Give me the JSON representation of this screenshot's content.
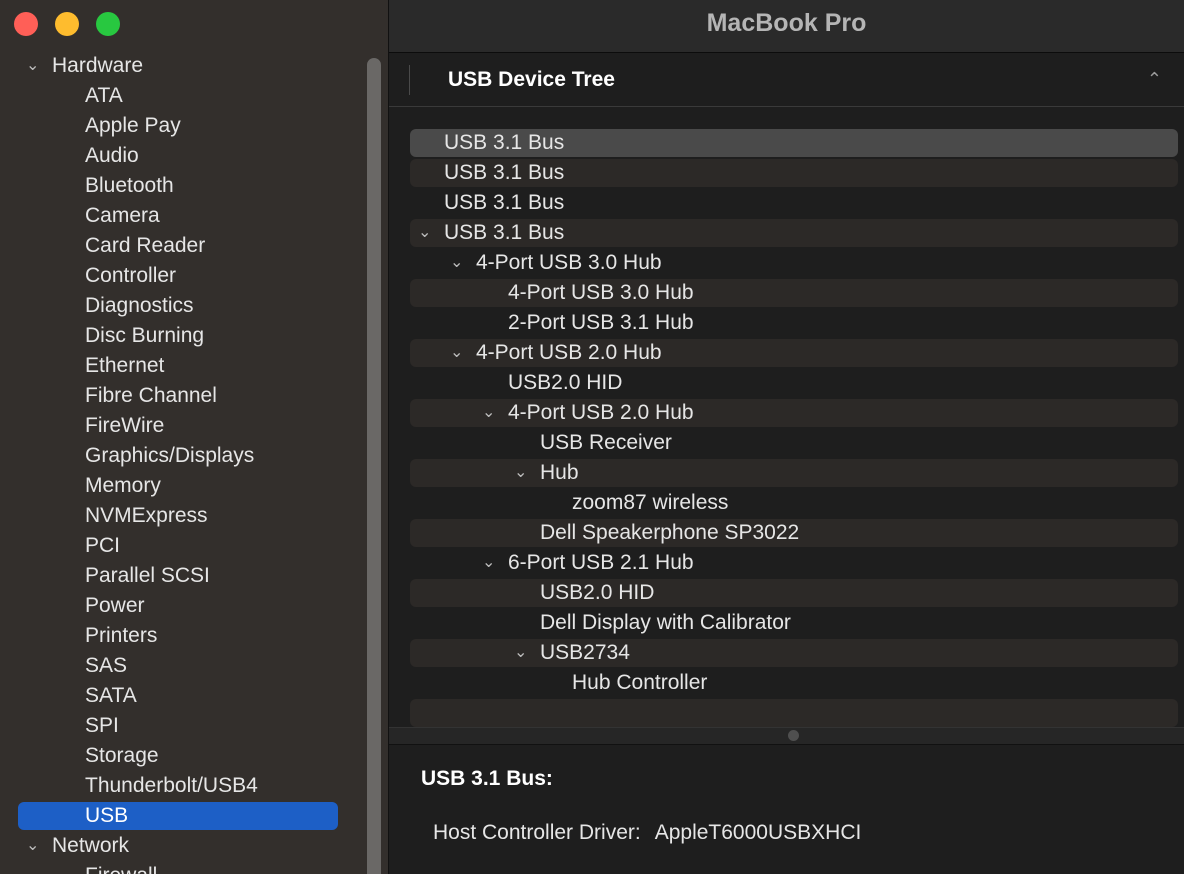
{
  "window": {
    "title": "MacBook Pro"
  },
  "sidebar": {
    "sections": [
      {
        "label": "Hardware",
        "expanded": true,
        "items": [
          "ATA",
          "Apple Pay",
          "Audio",
          "Bluetooth",
          "Camera",
          "Card Reader",
          "Controller",
          "Diagnostics",
          "Disc Burning",
          "Ethernet",
          "Fibre Channel",
          "FireWire",
          "Graphics/Displays",
          "Memory",
          "NVMExpress",
          "PCI",
          "Parallel SCSI",
          "Power",
          "Printers",
          "SAS",
          "SATA",
          "SPI",
          "Storage",
          "Thunderbolt/USB4",
          "USB"
        ],
        "selected": "USB"
      },
      {
        "label": "Network",
        "expanded": true,
        "items": [
          "Firewall"
        ]
      }
    ]
  },
  "content": {
    "column_header": "USB Device Tree",
    "sort_icon": "chevron-up-icon",
    "tree": [
      {
        "label": "USB 3.1 Bus",
        "level": 0,
        "expandable": false,
        "selected": true
      },
      {
        "label": "USB 3.1 Bus",
        "level": 0,
        "expandable": false
      },
      {
        "label": "USB 3.1 Bus",
        "level": 0,
        "expandable": false
      },
      {
        "label": "USB 3.1 Bus",
        "level": 0,
        "expandable": true
      },
      {
        "label": "4-Port USB 3.0 Hub",
        "level": 1,
        "expandable": true
      },
      {
        "label": "4-Port USB 3.0 Hub",
        "level": 2,
        "expandable": false
      },
      {
        "label": "2-Port USB 3.1 Hub",
        "level": 2,
        "expandable": false
      },
      {
        "label": "4-Port USB 2.0 Hub",
        "level": 1,
        "expandable": true
      },
      {
        "label": "USB2.0 HID",
        "level": 2,
        "expandable": false
      },
      {
        "label": "4-Port USB 2.0 Hub",
        "level": 2,
        "expandable": true
      },
      {
        "label": "USB Receiver",
        "level": 3,
        "expandable": false
      },
      {
        "label": "Hub",
        "level": 3,
        "expandable": true
      },
      {
        "label": "zoom87 wireless",
        "level": 4,
        "expandable": false
      },
      {
        "label": "Dell Speakerphone SP3022",
        "level": 3,
        "expandable": false
      },
      {
        "label": "6-Port USB 2.1 Hub",
        "level": 2,
        "expandable": true
      },
      {
        "label": "USB2.0 HID",
        "level": 3,
        "expandable": false
      },
      {
        "label": "Dell Display with Calibrator",
        "level": 3,
        "expandable": false
      },
      {
        "label": "USB2734",
        "level": 3,
        "expandable": true
      },
      {
        "label": "Hub Controller",
        "level": 4,
        "expandable": false
      },
      {
        "label": "",
        "level": 0,
        "expandable": false
      }
    ],
    "detail": {
      "heading": "USB 3.1 Bus:",
      "fields": [
        {
          "key": "Host Controller Driver:",
          "value": "AppleT6000USBXHCI"
        }
      ]
    }
  },
  "colors": {
    "selection_accent": "#1d5fc6",
    "sidebar_bg": "#332f2c",
    "content_bg": "#1e1e1e",
    "traffic_red": "#ff5f57",
    "traffic_yellow": "#febc2e",
    "traffic_green": "#28c840"
  }
}
